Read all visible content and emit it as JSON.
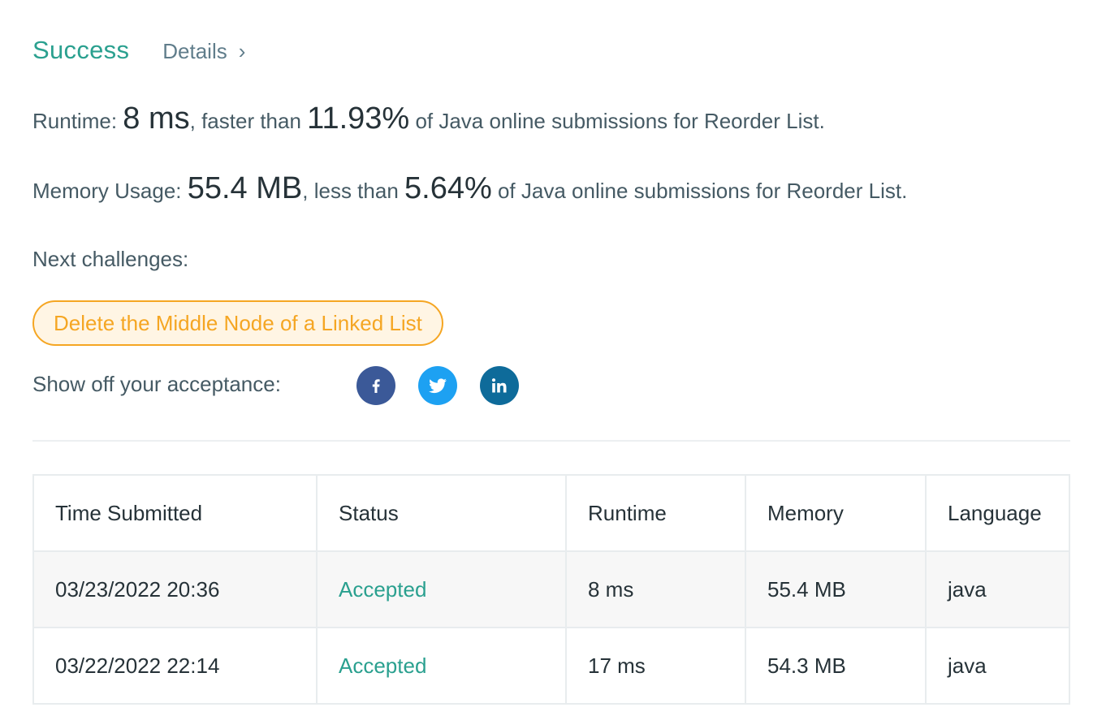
{
  "result": {
    "status": "Success",
    "details_label": "Details",
    "runtime": {
      "label": "Runtime: ",
      "value": "8 ms",
      "mid": ", faster than ",
      "percent": "11.93%",
      "suffix": " of Java online submissions for Reorder List."
    },
    "memory": {
      "label": "Memory Usage: ",
      "value": "55.4 MB",
      "mid": ", less than ",
      "percent": "5.64%",
      "suffix": " of Java online submissions for Reorder List."
    }
  },
  "next": {
    "label": "Next challenges:",
    "challenges": [
      "Delete the Middle Node of a Linked List"
    ]
  },
  "share": {
    "label": "Show off your acceptance:",
    "icons": [
      "facebook-icon",
      "twitter-icon",
      "linkedin-icon"
    ],
    "colors": {
      "facebook": "#3b5998",
      "twitter": "#1da1f2",
      "linkedin": "#0e6b9a"
    }
  },
  "table": {
    "headers": [
      "Time Submitted",
      "Status",
      "Runtime",
      "Memory",
      "Language"
    ],
    "rows": [
      [
        "03/23/2022 20:36",
        "Accepted",
        "8 ms",
        "55.4 MB",
        "java"
      ],
      [
        "03/22/2022 22:14",
        "Accepted",
        "17 ms",
        "54.3 MB",
        "java"
      ]
    ]
  },
  "colors": {
    "accent": "#2aa08f",
    "challenge": "#f5a623"
  }
}
